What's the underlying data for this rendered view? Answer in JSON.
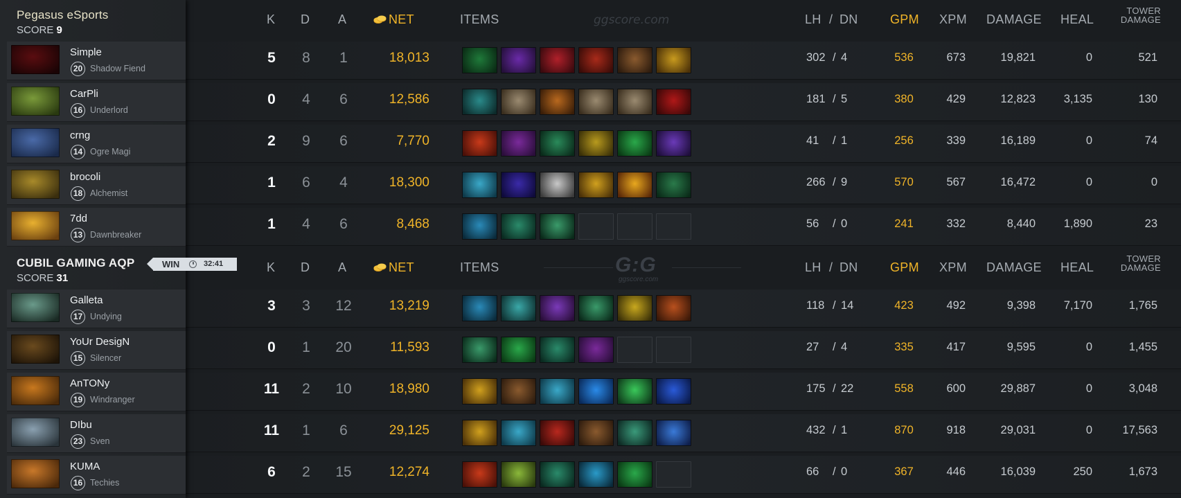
{
  "colors": {
    "accent_gold": "#f0b428",
    "background": "#1a1d20",
    "sidebar": "#2c2f33"
  },
  "headers": {
    "k": "K",
    "d": "D",
    "a": "A",
    "net": "NET",
    "items": "ITEMS",
    "lh": "LH",
    "slash": "/",
    "dn": "DN",
    "gpm": "GPM",
    "xpm": "XPM",
    "damage": "DAMAGE",
    "heal": "HEAL",
    "tower_1": "TOWER",
    "tower_2": "DAMAGE"
  },
  "watermark": {
    "site": "ggscore.com",
    "logo": "G:G"
  },
  "win_badge": {
    "label": "WIN",
    "time": "32:41"
  },
  "score_label": "SCORE",
  "teams": [
    {
      "name": "Pegasus eSports",
      "score": "9",
      "players": [
        {
          "name": "Simple",
          "level": "20",
          "hero": "Shadow Fiend",
          "k": "5",
          "d": "8",
          "a": "1",
          "net": "18,013",
          "lh": "302",
          "dn": "4",
          "gpm": "536",
          "xpm": "673",
          "damage": "19,821",
          "heal": "0",
          "tower": "521",
          "portrait": [
            "#5a0d10",
            "#1a0405"
          ],
          "items": [
            [
              "#1f7a3a",
              "#0a2a14"
            ],
            [
              "#6a2aa8",
              "#24103a"
            ],
            [
              "#b0202a",
              "#3a0a0e"
            ],
            [
              "#a82a1a",
              "#3a0c08"
            ],
            [
              "#8a5a2e",
              "#2e1c0e"
            ],
            [
              "#c89a1e",
              "#4a3008"
            ]
          ]
        },
        {
          "name": "CarPli",
          "level": "16",
          "hero": "Underlord",
          "k": "0",
          "d": "4",
          "a": "6",
          "net": "12,586",
          "lh": "181",
          "dn": "5",
          "gpm": "380",
          "xpm": "429",
          "damage": "12,823",
          "heal": "3,135",
          "tower": "130",
          "portrait": [
            "#7a9a3a",
            "#2a3a10"
          ],
          "items": [
            [
              "#2a8a8a",
              "#0c2a2a"
            ],
            [
              "#9a8a70",
              "#3a2e1e"
            ],
            [
              "#b8681e",
              "#3a1e08"
            ],
            [
              "#9a8a70",
              "#3a2e1e"
            ],
            [
              "#9a8a70",
              "#3a2e1e"
            ],
            [
              "#b01818",
              "#3a0808"
            ]
          ]
        },
        {
          "name": "crng",
          "level": "14",
          "hero": "Ogre Magi",
          "k": "2",
          "d": "9",
          "a": "6",
          "net": "7,770",
          "lh": "41",
          "dn": "1",
          "gpm": "256",
          "xpm": "339",
          "damage": "16,189",
          "heal": "0",
          "tower": "74",
          "portrait": [
            "#4a6aa8",
            "#1a2a4a"
          ],
          "items": [
            [
              "#c83a1a",
              "#4a1008"
            ],
            [
              "#7a2a9a",
              "#2a0e3a"
            ],
            [
              "#2a8a5a",
              "#0a2a1a"
            ],
            [
              "#b89a1e",
              "#3a3008"
            ],
            [
              "#2aa84a",
              "#0a3a14"
            ],
            [
              "#6a3ab8",
              "#1e0e3a"
            ]
          ]
        },
        {
          "name": "brocoli",
          "level": "18",
          "hero": "Alchemist",
          "k": "1",
          "d": "6",
          "a": "4",
          "net": "18,300",
          "lh": "266",
          "dn": "9",
          "gpm": "570",
          "xpm": "567",
          "damage": "16,472",
          "heal": "0",
          "tower": "0",
          "portrait": [
            "#a88a2a",
            "#3a2e0e"
          ],
          "items": [
            [
              "#3aa8c8",
              "#0e3a4a"
            ],
            [
              "#3a2aa8",
              "#0e0a3a"
            ],
            [
              "#c8c8c8",
              "#3a3a3a"
            ],
            [
              "#d0a01e",
              "#4a3008"
            ],
            [
              "#e8a81e",
              "#5a2808"
            ],
            [
              "#2a7a4a",
              "#0a2a18"
            ]
          ]
        },
        {
          "name": "7dd",
          "level": "13",
          "hero": "Dawnbreaker",
          "k": "1",
          "d": "4",
          "a": "6",
          "net": "8,468",
          "lh": "56",
          "dn": "0",
          "gpm": "241",
          "xpm": "332",
          "damage": "8,440",
          "heal": "1,890",
          "tower": "23",
          "portrait": [
            "#e8b030",
            "#6a4010"
          ],
          "items": [
            [
              "#2a8ab8",
              "#0a2a3a"
            ],
            [
              "#2a8a6a",
              "#0a2a20"
            ],
            [
              "#3a9a6a",
              "#0a2a1a"
            ],
            null,
            null,
            null
          ]
        }
      ]
    },
    {
      "name": "CUBIL GAMING AQP",
      "score": "31",
      "players": [
        {
          "name": "Galleta",
          "level": "17",
          "hero": "Undying",
          "k": "3",
          "d": "3",
          "a": "12",
          "net": "13,219",
          "lh": "118",
          "dn": "14",
          "gpm": "423",
          "xpm": "492",
          "damage": "9,398",
          "heal": "7,170",
          "tower": "1,765",
          "portrait": [
            "#6a9a8a",
            "#1a2a24"
          ],
          "items": [
            [
              "#2a8ab8",
              "#0a2a3a"
            ],
            [
              "#3aa8a8",
              "#0e3030"
            ],
            [
              "#7a3ab8",
              "#2a0e3a"
            ],
            [
              "#3a9a6a",
              "#0a2a1a"
            ],
            [
              "#c8a81e",
              "#3a3008"
            ],
            [
              "#b8501e",
              "#3a1808"
            ]
          ]
        },
        {
          "name": "YoUr DesigN",
          "level": "15",
          "hero": "Silencer",
          "k": "0",
          "d": "1",
          "a": "20",
          "net": "11,593",
          "lh": "27",
          "dn": "4",
          "gpm": "335",
          "xpm": "417",
          "damage": "9,595",
          "heal": "0",
          "tower": "1,455",
          "portrait": [
            "#6a4a1e",
            "#1e1408"
          ],
          "items": [
            [
              "#3a9a6a",
              "#0a2a1a"
            ],
            [
              "#2aa84a",
              "#0a3a14"
            ],
            [
              "#2a8a6a",
              "#0a2a20"
            ],
            [
              "#7a2a9a",
              "#2a0e3a"
            ],
            null,
            null
          ]
        },
        {
          "name": "AnTONy",
          "level": "19",
          "hero": "Windranger",
          "k": "11",
          "d": "2",
          "a": "10",
          "net": "18,980",
          "lh": "175",
          "dn": "22",
          "gpm": "558",
          "xpm": "600",
          "damage": "29,887",
          "heal": "0",
          "tower": "3,048",
          "portrait": [
            "#c8781e",
            "#4a2a0a"
          ],
          "items": [
            [
              "#d0a01e",
              "#4a3008"
            ],
            [
              "#8a5a2e",
              "#2e1c0e"
            ],
            [
              "#3aa8c8",
              "#0e3a4a"
            ],
            [
              "#2a8ae8",
              "#0a2a5a"
            ],
            [
              "#3ac85a",
              "#0e3a1a"
            ],
            [
              "#2a5ad8",
              "#0a1a4a"
            ]
          ]
        },
        {
          "name": "DIbu",
          "level": "23",
          "hero": "Sven",
          "k": "11",
          "d": "1",
          "a": "6",
          "net": "29,125",
          "lh": "432",
          "dn": "1",
          "gpm": "870",
          "xpm": "918",
          "damage": "29,031",
          "heal": "0",
          "tower": "17,563",
          "portrait": [
            "#8aa0b0",
            "#2a343a"
          ],
          "items": [
            [
              "#d0a01e",
              "#4a3008"
            ],
            [
              "#3aa8c8",
              "#0e3a4a"
            ],
            [
              "#b8281e",
              "#3a0a08"
            ],
            [
              "#8a5a2e",
              "#2e1c0e"
            ],
            [
              "#3a9a7a",
              "#0e2a24"
            ],
            [
              "#3a7ad8",
              "#0e1e4a"
            ]
          ]
        },
        {
          "name": "KUMA",
          "level": "16",
          "hero": "Techies",
          "k": "6",
          "d": "2",
          "a": "15",
          "net": "12,274",
          "lh": "66",
          "dn": "0",
          "gpm": "367",
          "xpm": "446",
          "damage": "16,039",
          "heal": "250",
          "tower": "1,673",
          "portrait": [
            "#c8782a",
            "#4a280a"
          ],
          "items": [
            [
              "#c83a1a",
              "#4a1008"
            ],
            [
              "#8ab83a",
              "#2a3a0e"
            ],
            [
              "#2a8a6a",
              "#0a2a20"
            ],
            [
              "#2a9ac8",
              "#0a2a3a"
            ],
            [
              "#2aa84a",
              "#0a3a14"
            ],
            null
          ]
        }
      ]
    }
  ]
}
